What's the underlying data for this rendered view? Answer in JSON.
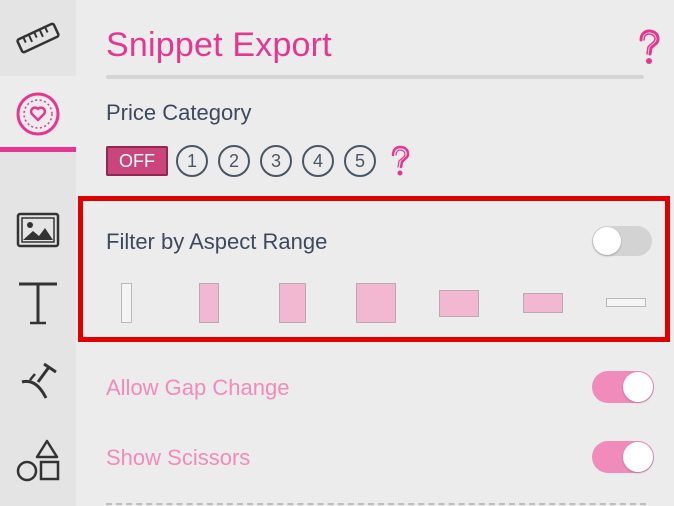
{
  "sidebar": {
    "items": [
      {
        "icon": "ruler-icon"
      },
      {
        "icon": "heart-badge-icon",
        "active": true
      },
      {
        "icon": "image-icon"
      },
      {
        "icon": "text-icon"
      },
      {
        "icon": "crop-tool-icon"
      },
      {
        "icon": "shapes-icon"
      }
    ]
  },
  "header": {
    "title": "Snippet Export",
    "help_icon": "question-icon"
  },
  "price": {
    "label": "Price Category",
    "off_label": "OFF",
    "levels": [
      "1",
      "2",
      "3",
      "4",
      "5"
    ]
  },
  "aspect": {
    "label": "Filter by Aspect Range",
    "enabled": false
  },
  "gap": {
    "label": "Allow Gap Change",
    "enabled": true
  },
  "scissors": {
    "label": "Show Scissors",
    "enabled": true
  },
  "colors": {
    "accent": "#e8368f",
    "accent_light": "#f08bbb",
    "highlight_box": "#e00000",
    "text": "#3d4a5e"
  }
}
